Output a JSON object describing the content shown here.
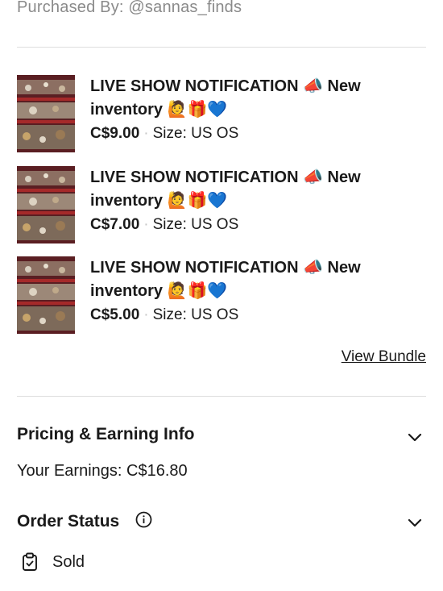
{
  "header": {
    "purchased_by": "Purchased By:  @sannas_finds"
  },
  "items": [
    {
      "title": "LIVE SHOW NOTIFICATION 📣 New inventory 🙋🎁💙",
      "price": "C$9.00",
      "size": "Size: US OS"
    },
    {
      "title": "LIVE SHOW NOTIFICATION 📣 New inventory 🙋🎁💙",
      "price": "C$7.00",
      "size": "Size: US OS"
    },
    {
      "title": "LIVE SHOW NOTIFICATION 📣 New inventory 🙋🎁💙",
      "price": "C$5.00",
      "size": "Size: US OS"
    }
  ],
  "bundle": {
    "view_label": "View Bundle"
  },
  "pricing": {
    "title": "Pricing & Earning Info",
    "earnings": "Your Earnings: C$16.80"
  },
  "order_status": {
    "title": "Order Status",
    "status": "Sold"
  },
  "icons": {
    "chevron": "chevron-down-icon",
    "info": "info-icon",
    "clipboard": "clipboard-check-icon"
  }
}
